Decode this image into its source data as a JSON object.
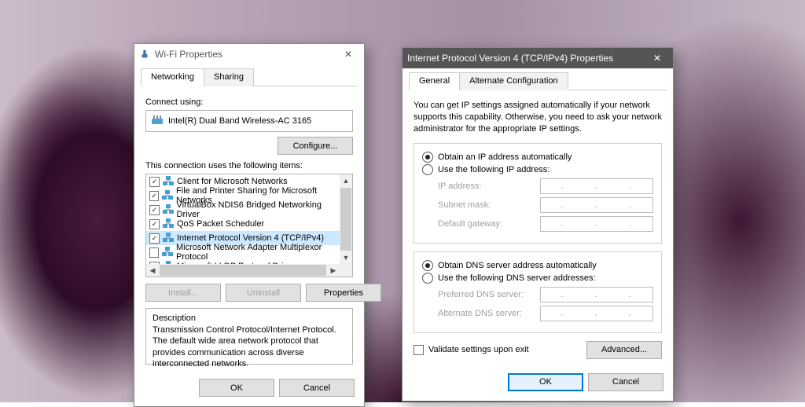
{
  "wifi": {
    "title": "Wi-Fi Properties",
    "tabs": {
      "networking": "Networking",
      "sharing": "Sharing"
    },
    "connect_using_label": "Connect using:",
    "adapter": "Intel(R) Dual Band Wireless-AC 3165",
    "configure_btn": "Configure...",
    "items_label": "This connection uses the following items:",
    "items": [
      {
        "checked": true,
        "label": "Client for Microsoft Networks",
        "selected": false
      },
      {
        "checked": true,
        "label": "File and Printer Sharing for Microsoft Networks",
        "selected": false
      },
      {
        "checked": true,
        "label": "VirtualBox NDIS6 Bridged Networking Driver",
        "selected": false
      },
      {
        "checked": true,
        "label": "QoS Packet Scheduler",
        "selected": false
      },
      {
        "checked": true,
        "label": "Internet Protocol Version 4 (TCP/IPv4)",
        "selected": true
      },
      {
        "checked": false,
        "label": "Microsoft Network Adapter Multiplexor Protocol",
        "selected": false
      },
      {
        "checked": true,
        "label": "Microsoft LLDP Protocol Driver",
        "selected": false
      }
    ],
    "install_btn": "Install...",
    "uninstall_btn": "Uninstall",
    "properties_btn": "Properties",
    "desc_heading": "Description",
    "desc_text": "Transmission Control Protocol/Internet Protocol. The default wide area network protocol that provides communication across diverse interconnected networks.",
    "ok_btn": "OK",
    "cancel_btn": "Cancel"
  },
  "ipv4": {
    "title": "Internet Protocol Version 4 (TCP/IPv4) Properties",
    "tabs": {
      "general": "General",
      "alt": "Alternate Configuration"
    },
    "note": "You can get IP settings assigned automatically if your network supports this capability. Otherwise, you need to ask your network administrator for the appropriate IP settings.",
    "ip": {
      "auto_label": "Obtain an IP address automatically",
      "manual_label": "Use the following IP address:",
      "selected": "auto",
      "fields": {
        "ip_address": "IP address:",
        "subnet_mask": "Subnet mask:",
        "default_gateway": "Default gateway:"
      }
    },
    "dns": {
      "auto_label": "Obtain DNS server address automatically",
      "manual_label": "Use the following DNS server addresses:",
      "selected": "auto",
      "fields": {
        "preferred": "Preferred DNS server:",
        "alternate": "Alternate DNS server:"
      }
    },
    "validate_label": "Validate settings upon exit",
    "advanced_btn": "Advanced...",
    "ok_btn": "OK",
    "cancel_btn": "Cancel"
  }
}
